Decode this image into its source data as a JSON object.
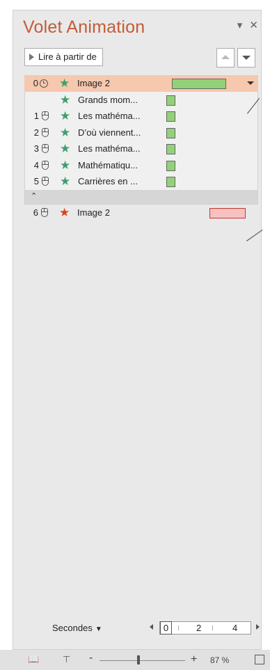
{
  "pane": {
    "title": "Volet Animation",
    "play_label": "Lire à partir de",
    "controls": [
      "▾",
      "✕"
    ]
  },
  "rows": [
    {
      "num": "0",
      "trigger": "clock",
      "star": "green",
      "label": "Image 2",
      "bar": "green",
      "selected": true
    },
    {
      "num": "",
      "trigger": "",
      "star": "green",
      "label": "Grands mom...",
      "bar": "green"
    },
    {
      "num": "1",
      "trigger": "mouse",
      "star": "green",
      "label": "Les mathéma...",
      "bar": "green"
    },
    {
      "num": "2",
      "trigger": "mouse",
      "star": "green",
      "label": "D’où viennent...",
      "bar": "green"
    },
    {
      "num": "3",
      "trigger": "mouse",
      "star": "green",
      "label": "Les mathéma...",
      "bar": "green"
    },
    {
      "num": "4",
      "trigger": "mouse",
      "star": "green",
      "label": "Mathématiqu...",
      "bar": "green"
    },
    {
      "num": "5",
      "trigger": "mouse",
      "star": "green",
      "label": "Carrières en ...",
      "bar": "green"
    },
    {
      "num": "6",
      "trigger": "mouse",
      "star": "red",
      "label": "Image 2",
      "bar": "red"
    }
  ],
  "collapse_glyph": "⌃",
  "timeline": {
    "unit_label": "Secondes",
    "ticks": [
      "0",
      "2",
      "4"
    ]
  },
  "status": {
    "zoom": "87 %",
    "minus": "-",
    "plus": "+"
  },
  "colors": {
    "accent": "#c55a36",
    "selected_row": "#f6c8ae",
    "green_star": "#3f9e6f",
    "red_star": "#d8451c",
    "green_bar": "#92d178",
    "red_bar": "#f7c1c1"
  }
}
